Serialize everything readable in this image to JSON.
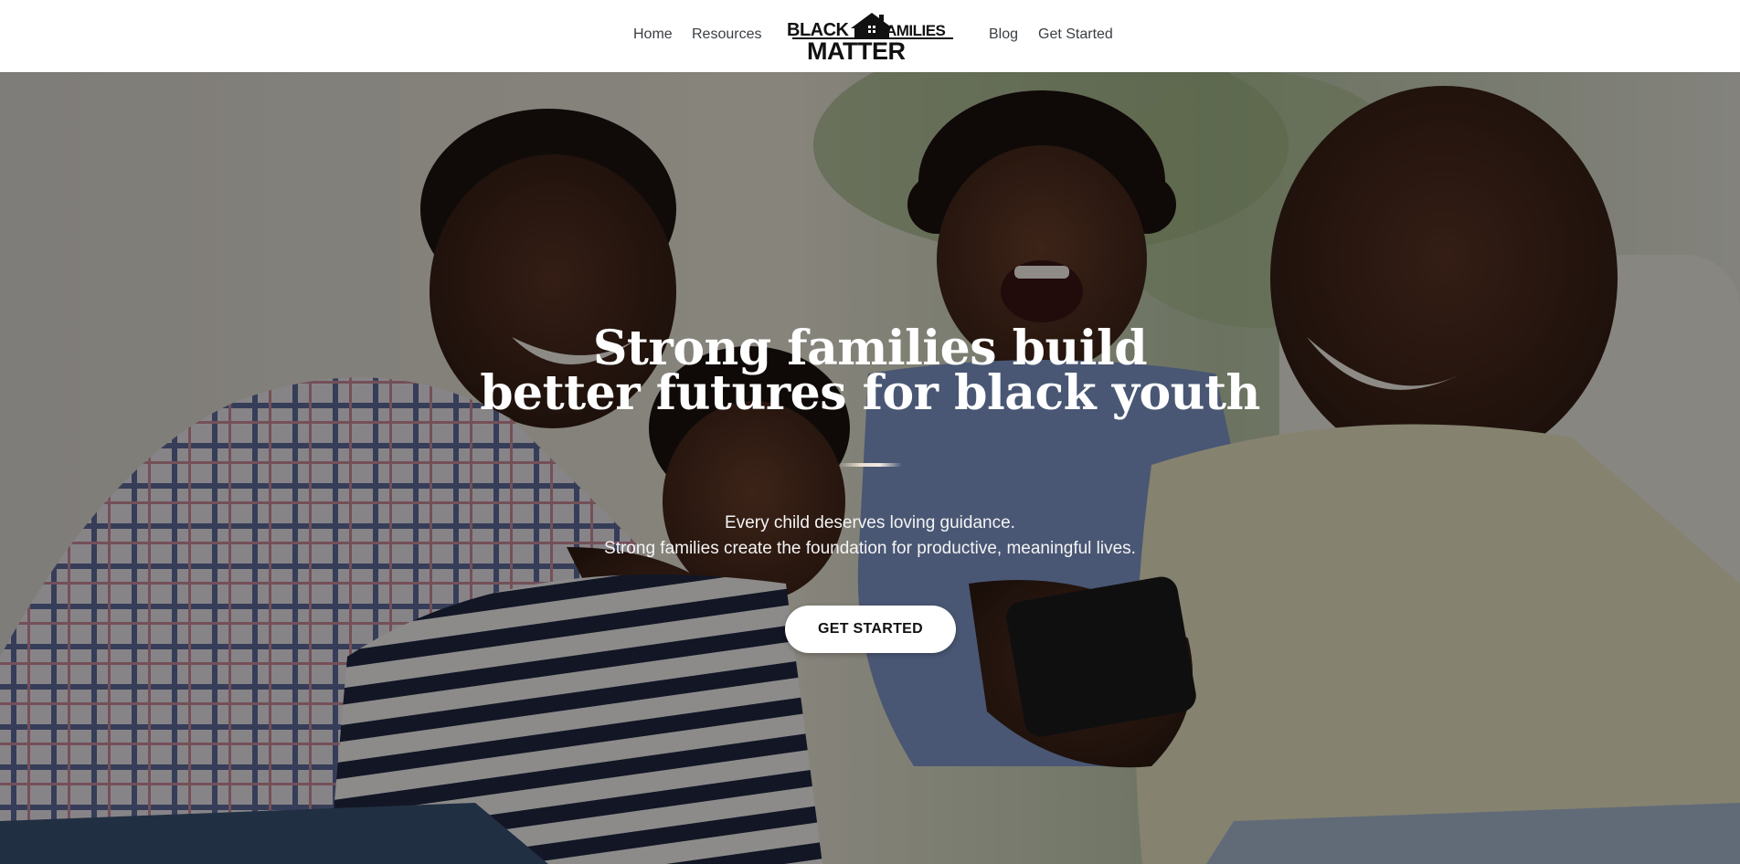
{
  "nav": {
    "home": "Home",
    "resources": "Resources",
    "blog": "Blog",
    "get_started": "Get Started"
  },
  "logo": {
    "text_line1_left": "BLACK",
    "text_line1_right": "FAMILIES",
    "text_line2": "MATTER"
  },
  "hero": {
    "title_line1": "Strong families build",
    "title_line2": "better futures for black youth",
    "subtitle_line1": "Every child deserves loving guidance.",
    "subtitle_line2": "Strong families create the foundation for productive, meaningful lives.",
    "cta_label": "GET STARTED"
  },
  "colors": {
    "header_bg": "#ffffff",
    "nav_text": "#3a3f44",
    "hero_text": "#ffffff",
    "cta_bg": "#ffffff",
    "cta_text": "#111111"
  }
}
